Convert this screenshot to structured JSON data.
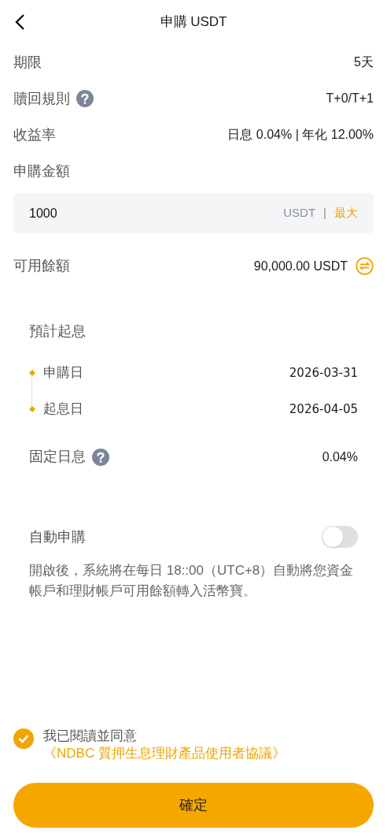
{
  "header": {
    "title": "申購 USDT"
  },
  "details": [
    {
      "label": "期限",
      "help": false,
      "value": "5天"
    },
    {
      "label": "贖回規則",
      "help": true,
      "value": "T+0/T+1"
    },
    {
      "label": "收益率",
      "help": false,
      "value": "日息 0.04% | 年化 12.00%"
    }
  ],
  "amount": {
    "label": "申購金額",
    "value": "1000",
    "unit": "USDT",
    "separator": "|",
    "max": "最大"
  },
  "balance": {
    "label": "可用餘額",
    "value": "90,000.00 USDT"
  },
  "schedule": {
    "title": "預計起息",
    "steps": [
      {
        "label": "申購日",
        "date": "2026-03-31"
      },
      {
        "label": "起息日",
        "date": "2026-04-05"
      }
    ],
    "fixed_rate": {
      "label": "固定日息",
      "help": true,
      "value": "0.04%"
    }
  },
  "auto": {
    "label": "自動申購",
    "on": false,
    "description": "開啟後，系統將在每日 18::00（UTC+8）自動將您資金帳戶和理財帳戶可用餘額轉入活幣寶。"
  },
  "agreement": {
    "checked": true,
    "text": "我已閱讀並同意",
    "link": "《NDBC 質押生息理財產品使用者協議》"
  },
  "confirm": "確定"
}
